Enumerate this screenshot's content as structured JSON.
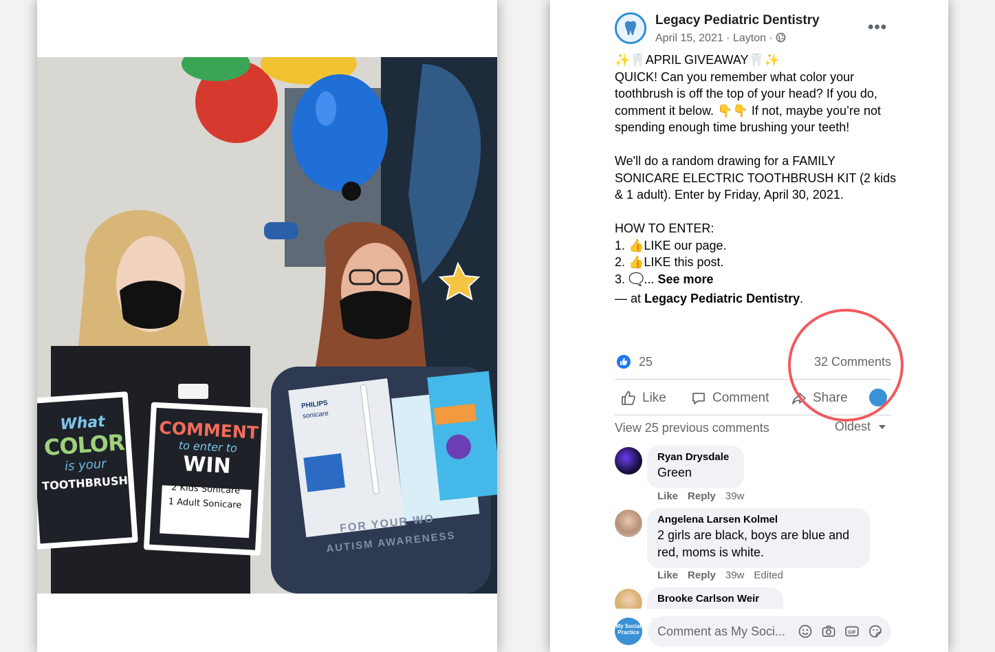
{
  "post": {
    "page_name": "Legacy Pediatric Dentistry",
    "date": "April 15, 2021",
    "location": "Layton",
    "meta_sep": " · ",
    "more": "•••",
    "lines": {
      "l1": "✨🦷APRIL GIVEAWAY🦷✨",
      "l2": "QUICK! Can you remember what color your toothbrush is off the top of your head? If you do, comment it below. 👇👇 If not, maybe you’re not spending enough time brushing your teeth!",
      "l3": "We'll do a random drawing for a FAMILY SONICARE ELECTRIC TOOTHBRUSH KIT (2 kids & 1 adult). Enter by Friday, April 30, 2021.",
      "l4": "HOW TO ENTER:",
      "l5": "1. 👍LIKE our page.",
      "l6": "2. 👍LIKE this post.",
      "l7_prefix": "3. 🗨️... ",
      "see_more": "See more",
      "at_prefix": "— at ",
      "at_place": "Legacy Pediatric Dentistry",
      "at_suffix": "."
    },
    "reaction_count": "25",
    "comments_count": "32 Comments"
  },
  "actions": {
    "like": "Like",
    "comment": "Comment",
    "share": "Share"
  },
  "comments_header": {
    "view_previous": "View 25 previous comments",
    "sort": "Oldest"
  },
  "comments": [
    {
      "name": "Ryan Drysdale",
      "text": "Green",
      "like": "Like",
      "reply": "Reply",
      "time": "39w",
      "edited": ""
    },
    {
      "name": "Angelena Larsen Kolmel",
      "text": "2 girls are black, boys are blue and red, moms is white.",
      "like": "Like",
      "reply": "Reply",
      "time": "39w",
      "edited": "Edited"
    },
    {
      "name": "Brooke Carlson Weir",
      "text": "",
      "like": "",
      "reply": "",
      "time": "",
      "edited": ""
    }
  ],
  "composer": {
    "placeholder": "Comment as My Soci...",
    "avatar_text": "My Social Practice"
  },
  "photo": {
    "sign_left": {
      "line1": "What",
      "line2": "COLOR",
      "line3": "is your",
      "line4": "TOOTHBRUSH?"
    },
    "sign_right": {
      "line1": "COMMENT",
      "line2": "to enter to",
      "line3": "WIN",
      "line4": "2 Kids Sonicare",
      "line5": "1 Adult Sonicare"
    },
    "box_brand": "PHILIPS",
    "box_product": "sonicare",
    "shirt_text_1": "FOR YOUR WO",
    "shirt_text_2": "AUTISM AWARENESS"
  },
  "icons": {
    "verified_like": "like-reaction-icon",
    "globe": "globe-icon",
    "emoji": "emoji-icon",
    "camera": "camera-icon",
    "gif": "gif-icon",
    "sticker": "sticker-icon"
  },
  "colors": {
    "accent": "#2078f4",
    "highlight_ring": "#f0595d"
  }
}
